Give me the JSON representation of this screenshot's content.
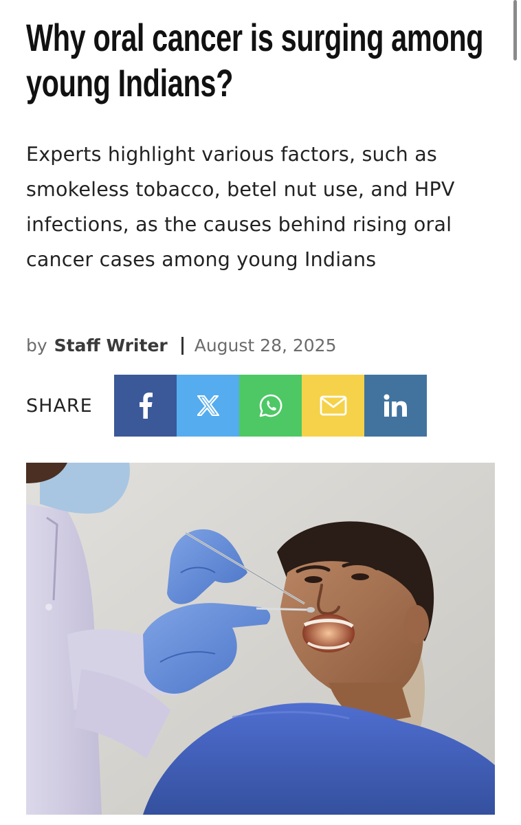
{
  "article": {
    "headline": "Why oral cancer is surging among young Indians?",
    "subtitle": "Experts highlight various factors, such as smokeless tobacco, betel nut use, and HPV infections, as the causes behind rising oral cancer cases among young Indians",
    "byline": {
      "prefix": "by",
      "author": "Staff Writer",
      "date": "August 28, 2025"
    }
  },
  "share": {
    "label": "SHARE",
    "buttons": [
      {
        "id": "facebook",
        "icon": "facebook-icon",
        "color": "#3b5998"
      },
      {
        "id": "x",
        "icon": "x-icon",
        "color": "#55acee"
      },
      {
        "id": "whatsapp",
        "icon": "whatsapp-icon",
        "color": "#4dc865"
      },
      {
        "id": "email",
        "icon": "email-icon",
        "color": "#f5d249"
      },
      {
        "id": "linkedin",
        "icon": "linkedin-icon",
        "color": "#42739f"
      }
    ]
  },
  "hero_image": {
    "description_icon": "photo"
  }
}
